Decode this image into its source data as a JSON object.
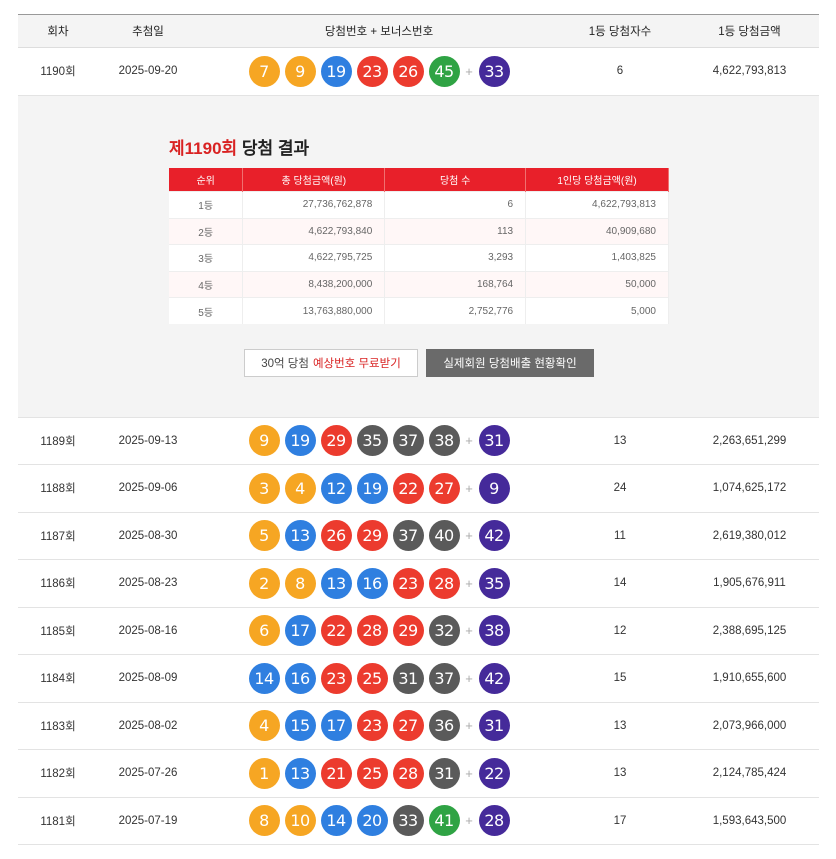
{
  "header": {
    "round": "회차",
    "date": "추첨일",
    "numbers": "당첨번호 + 보너스번호",
    "winners": "1등 당첨자수",
    "amount": "1등 당첨금액"
  },
  "ball_colors": {
    "yellow": "#f6a623",
    "blue": "#2f7fe0",
    "red": "#ec3b2e",
    "gray": "#5a5a5a",
    "green": "#2fa344",
    "purple": "#452a9a"
  },
  "plus_sign": "+",
  "draws": [
    {
      "round": "1190회",
      "date": "2025-09-20",
      "numbers": [
        "7",
        "9",
        "19",
        "23",
        "26",
        "45"
      ],
      "colors": [
        "yellow",
        "yellow",
        "blue",
        "red",
        "red",
        "green"
      ],
      "bonus": "33",
      "winners": "6",
      "amount": "4,622,793,813"
    },
    {
      "round": "1189회",
      "date": "2025-09-13",
      "numbers": [
        "9",
        "19",
        "29",
        "35",
        "37",
        "38"
      ],
      "colors": [
        "yellow",
        "blue",
        "red",
        "gray",
        "gray",
        "gray"
      ],
      "bonus": "31",
      "winners": "13",
      "amount": "2,263,651,299"
    },
    {
      "round": "1188회",
      "date": "2025-09-06",
      "numbers": [
        "3",
        "4",
        "12",
        "19",
        "22",
        "27"
      ],
      "colors": [
        "yellow",
        "yellow",
        "blue",
        "blue",
        "red",
        "red"
      ],
      "bonus": "9",
      "winners": "24",
      "amount": "1,074,625,172"
    },
    {
      "round": "1187회",
      "date": "2025-08-30",
      "numbers": [
        "5",
        "13",
        "26",
        "29",
        "37",
        "40"
      ],
      "colors": [
        "yellow",
        "blue",
        "red",
        "red",
        "gray",
        "gray"
      ],
      "bonus": "42",
      "winners": "11",
      "amount": "2,619,380,012"
    },
    {
      "round": "1186회",
      "date": "2025-08-23",
      "numbers": [
        "2",
        "8",
        "13",
        "16",
        "23",
        "28"
      ],
      "colors": [
        "yellow",
        "yellow",
        "blue",
        "blue",
        "red",
        "red"
      ],
      "bonus": "35",
      "winners": "14",
      "amount": "1,905,676,911"
    },
    {
      "round": "1185회",
      "date": "2025-08-16",
      "numbers": [
        "6",
        "17",
        "22",
        "28",
        "29",
        "32"
      ],
      "colors": [
        "yellow",
        "blue",
        "red",
        "red",
        "red",
        "gray"
      ],
      "bonus": "38",
      "winners": "12",
      "amount": "2,388,695,125"
    },
    {
      "round": "1184회",
      "date": "2025-08-09",
      "numbers": [
        "14",
        "16",
        "23",
        "25",
        "31",
        "37"
      ],
      "colors": [
        "blue",
        "blue",
        "red",
        "red",
        "gray",
        "gray"
      ],
      "bonus": "42",
      "winners": "15",
      "amount": "1,910,655,600"
    },
    {
      "round": "1183회",
      "date": "2025-08-02",
      "numbers": [
        "4",
        "15",
        "17",
        "23",
        "27",
        "36"
      ],
      "colors": [
        "yellow",
        "blue",
        "blue",
        "red",
        "red",
        "gray"
      ],
      "bonus": "31",
      "winners": "13",
      "amount": "2,073,966,000"
    },
    {
      "round": "1182회",
      "date": "2025-07-26",
      "numbers": [
        "1",
        "13",
        "21",
        "25",
        "28",
        "31"
      ],
      "colors": [
        "yellow",
        "blue",
        "red",
        "red",
        "red",
        "gray"
      ],
      "bonus": "22",
      "winners": "13",
      "amount": "2,124,785,424"
    },
    {
      "round": "1181회",
      "date": "2025-07-19",
      "numbers": [
        "8",
        "10",
        "14",
        "20",
        "33",
        "41"
      ],
      "colors": [
        "yellow",
        "yellow",
        "blue",
        "blue",
        "gray",
        "green"
      ],
      "bonus": "28",
      "winners": "17",
      "amount": "1,593,643,500"
    }
  ],
  "detail": {
    "title_red": "제1190회",
    "title_rest": " 당첨 결과",
    "table_headers": [
      "순위",
      "총 당첨금액(원)",
      "당첨 수",
      "1인당 당첨금액(원)"
    ],
    "rows": [
      {
        "rank": "1등",
        "total": "27,736,762,878",
        "count": "6",
        "per": "4,622,793,813"
      },
      {
        "rank": "2등",
        "total": "4,622,793,840",
        "count": "113",
        "per": "40,909,680"
      },
      {
        "rank": "3등",
        "total": "4,622,795,725",
        "count": "3,293",
        "per": "1,403,825"
      },
      {
        "rank": "4등",
        "total": "8,438,200,000",
        "count": "168,764",
        "per": "50,000"
      },
      {
        "rank": "5등",
        "total": "13,763,880,000",
        "count": "2,752,776",
        "per": "5,000"
      }
    ],
    "button_a_prefix": "30억 당첨",
    "button_a_highlight": "예상번호 무료받기",
    "button_b": "실제회원 당첨배출 현황확인"
  }
}
